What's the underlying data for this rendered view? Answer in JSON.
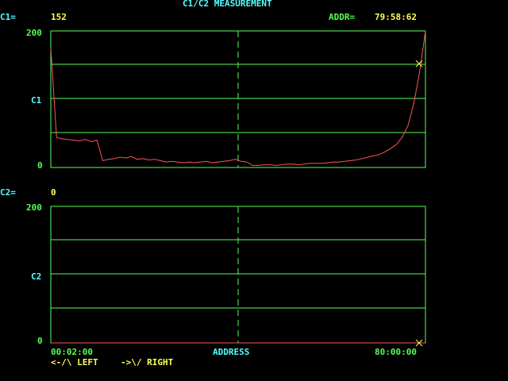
{
  "header": {
    "title": "C1/C2 MEASUREMENT",
    "c1_label": "C1=",
    "c1_value": "152",
    "addr_label": "ADDR=",
    "addr_value": "79:58:62",
    "c2_label": "C2=",
    "c2_value": "0"
  },
  "plots": [
    {
      "axis_max": "200",
      "axis_mid": "C1",
      "axis_min": "0"
    },
    {
      "axis_max": "200",
      "axis_mid": "C2",
      "axis_min": "0"
    }
  ],
  "footer": {
    "x_start": "00:02:00",
    "x_label": "ADDRESS",
    "x_end": "80:00:00",
    "nav_left": "<-/\\ LEFT",
    "nav_right": "->\\/ RIGHT"
  },
  "colors": {
    "title": "#55FFFF",
    "value": "#FFFF55",
    "grid": "#55FF55",
    "trace": "#FF5555",
    "cursor": "#FFFF55"
  },
  "chart_data": [
    {
      "type": "line",
      "series": [
        {
          "values": [
            175,
            44,
            42,
            41,
            40,
            39,
            41,
            38,
            40,
            10,
            12,
            13,
            15,
            14,
            16,
            12,
            13,
            11,
            12,
            10,
            8,
            9,
            8,
            7,
            8,
            7,
            8,
            9,
            7,
            8,
            9,
            10,
            12,
            9,
            8,
            3,
            3,
            4,
            4,
            3,
            4,
            5,
            5,
            4,
            5,
            6,
            6,
            6,
            7,
            8,
            8,
            9,
            10,
            11,
            13,
            15,
            17,
            19,
            23,
            28,
            34,
            45,
            62,
            95,
            140,
            200
          ]
        }
      ],
      "ylim": [
        0,
        200
      ],
      "cursor_value": 152
    },
    {
      "type": "line",
      "series": [
        {
          "values": [
            0,
            0,
            0,
            0,
            0,
            0,
            0,
            0,
            0,
            0,
            0,
            0,
            0,
            0,
            0,
            0,
            0,
            0,
            0,
            0,
            0,
            0,
            0,
            0,
            0,
            0,
            0,
            0,
            0,
            0,
            0,
            0,
            0,
            0,
            0,
            0,
            0,
            0,
            0,
            0,
            0,
            0,
            0,
            0,
            0,
            0,
            0,
            0,
            0,
            0,
            0,
            0,
            0,
            0,
            0,
            0,
            0,
            0,
            0,
            0,
            0,
            0,
            0,
            0,
            0,
            0
          ]
        }
      ],
      "ylim": [
        0,
        200
      ],
      "cursor_value": 0
    }
  ]
}
